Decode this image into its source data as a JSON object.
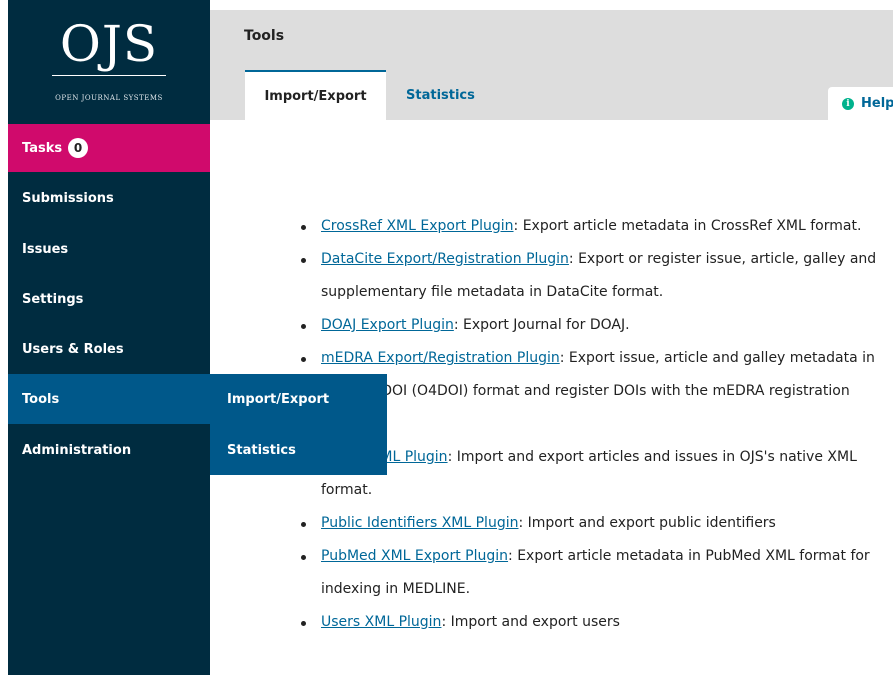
{
  "logo": {
    "title": "OJS",
    "subtitle": "OPEN JOURNAL SYSTEMS"
  },
  "nav": {
    "tasks": {
      "label": "Tasks",
      "count": "0"
    },
    "items": [
      "Submissions",
      "Issues",
      "Settings",
      "Users & Roles",
      "Tools",
      "Administration"
    ]
  },
  "flyout": {
    "items": [
      "Import/Export",
      "Statistics"
    ]
  },
  "header": {
    "title": "Tools",
    "tabs": [
      "Import/Export",
      "Statistics"
    ],
    "help": "Help"
  },
  "plugins": [
    {
      "name": "CrossRef XML Export Plugin",
      "description": ": Export article metadata in CrossRef XML format."
    },
    {
      "name": "DataCite Export/Registration Plugin",
      "description": ": Export or register issue, article, galley and supplementary file metadata in DataCite format."
    },
    {
      "name": "DOAJ Export Plugin",
      "description": ": Export Journal for DOAJ."
    },
    {
      "name": "mEDRA Export/Registration Plugin",
      "description": ": Export issue, article and galley metadata in Onix for DOI (O4DOI) format and register DOIs with the mEDRA registration agency."
    },
    {
      "name": "Native XML Plugin",
      "description": ": Import and export articles and issues in OJS's native XML format."
    },
    {
      "name": "Public Identifiers XML Plugin",
      "description": ": Import and export public identifiers"
    },
    {
      "name": "PubMed XML Export Plugin",
      "description": ": Export article metadata in PubMed XML format for indexing in MEDLINE."
    },
    {
      "name": "Users XML Plugin",
      "description": ": Import and export users"
    }
  ],
  "colors": {
    "sidebar": "#002c40",
    "tasks": "#d00a6c",
    "active": "#00588a",
    "link": "#006798"
  }
}
